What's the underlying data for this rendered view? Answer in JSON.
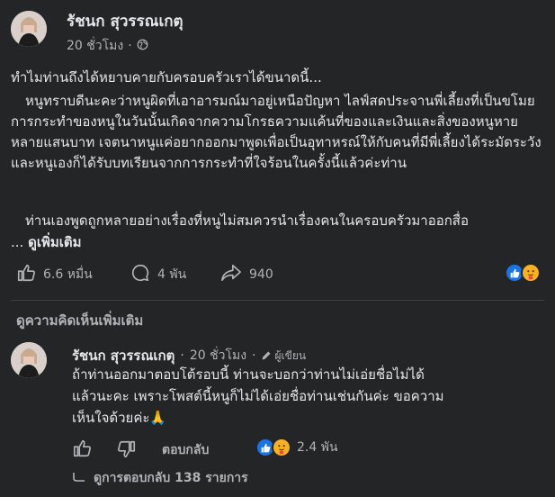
{
  "post": {
    "author": "รัชนก สุวรรณเกตุ",
    "time": "20 ชั่วโมง",
    "separator": "·",
    "paragraphs": [
      "ทำไมท่านถึงได้หยาบคายกับครอบครัวเราได้ขนาดนี้...",
      "หนูทราบดีนะคะว่าหนูผิดที่เอาอารมณ์มาอยู่เหนือปัญหา ไลฟ์สดประจานพี่เลี้ยงที่เป็นขโมย การกระทำของหนูในวันนั้นเกิดจากความโกรธความแค้นที่ของและเงินและสิ่งของหนูหายหลายแสนบาท เจตนาหนูแค่อยากออกมาพูดเพื่อเป็นอุทาหรณ์ให้กับคนที่มีพี่เลี้ยงได้ระมัดระวัง และหนูเองก็ได้รับบทเรียนจากการกระทำที่ใจร้อนในครั้งนี้แล้วค่ะท่าน",
      "ท่านเองพูดถูกหลายอย่างเรื่องที่หนูไม่สมควรนำเรื่องคนในครอบครัวมาออกสื่อ"
    ],
    "ellipsis": "...",
    "see_more": "ดูเพิ่มเติม",
    "stats": {
      "likes": "6.6 หมื่น",
      "comments": "4 พัน",
      "shares": "940"
    }
  },
  "comments_section": {
    "view_more": "ดูความคิดเห็นเพิ่มเติม",
    "comment": {
      "author": "รัชนก สุวรรณเกตุ",
      "time": "20 ชั่วโมง",
      "badge": "ผู้เขียน",
      "separator": "·",
      "text_line1": "ถ้าท่านออกมาตอบโต้รอบนี้ ท่านจะบอกว่าท่านไม่เอ่ยชื่อไม่ได้",
      "text_line2": "แล้วนะคะ เพราะโพสต์นี้หนูก็ไม่ได้เอ่ยชื่อท่านเช่นกันค่ะ ขอความ",
      "text_line3": "เห็นใจด้วยค่ะ🙏",
      "reply_label": "ตอบกลับ",
      "reaction_count": "2.4 พัน",
      "view_replies": "ดูการตอบกลับ 138 รายการ"
    }
  },
  "colors": {
    "background": "#242526",
    "text": "#e4e6eb",
    "muted": "#b0b3b8",
    "like_blue": "#1b74e4"
  },
  "icons": [
    "globe-icon",
    "like-icon",
    "comment-icon",
    "share-icon",
    "dislike-icon",
    "reply-arrow-icon"
  ]
}
